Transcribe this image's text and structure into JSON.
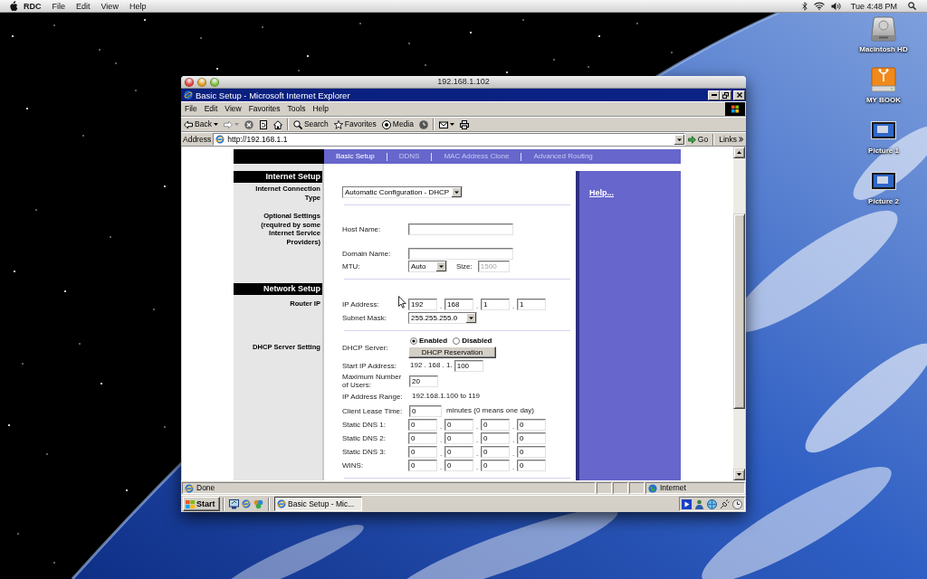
{
  "mac_menu_bar": {
    "app": "RDC",
    "menus": [
      "File",
      "Edit",
      "View",
      "Help"
    ],
    "clock": "Tue 4:48 PM"
  },
  "desktop_icons": [
    {
      "kind": "hard-drive",
      "label": "Macintosh HD"
    },
    {
      "kind": "external-drive",
      "label": "MY BOOK"
    },
    {
      "kind": "picture",
      "label": "Picture 1"
    },
    {
      "kind": "picture",
      "label": "Picture 2"
    }
  ],
  "remote_window": {
    "title": "192.168.1.102"
  },
  "browser": {
    "title": "Basic Setup - Microsoft Internet Explorer",
    "menus": [
      "File",
      "Edit",
      "View",
      "Favorites",
      "Tools",
      "Help"
    ],
    "toolbar": [
      [
        {
          "kind": "back",
          "label": "Back",
          "disabled": false
        },
        {
          "kind": "forward",
          "disabled": true
        },
        {
          "kind": "stop",
          "disabled": false
        },
        {
          "kind": "refresh",
          "disabled": false
        },
        {
          "kind": "home",
          "disabled": false
        }
      ],
      [
        {
          "kind": "search",
          "label": "Search",
          "disabled": false
        },
        {
          "kind": "favorites",
          "label": "Favorites",
          "disabled": false
        },
        {
          "kind": "media",
          "label": "Media",
          "disabled": false
        },
        {
          "kind": "history",
          "disabled": false
        }
      ],
      [
        {
          "kind": "mail",
          "disabled": false
        },
        {
          "kind": "print",
          "disabled": false
        }
      ]
    ],
    "address": {
      "label": "Address",
      "url": "http://192.168.1.1",
      "go": "Go",
      "links": "Links"
    },
    "status_bar": {
      "text": "Done",
      "zone": "Internet"
    }
  },
  "router_page": {
    "nav_tabs": [
      {
        "label": "Basic Setup",
        "selected": true
      },
      {
        "label": "DDNS",
        "selected": false
      },
      {
        "label": "MAC Address Clone",
        "selected": false
      },
      {
        "label": "Advanced Routing",
        "selected": false
      }
    ],
    "help_link": "Help...",
    "ip_separator": ".",
    "sections": [
      {
        "heading": "Internet Setup",
        "groups": [
          {
            "label": "Internet Connection Type",
            "rows": [
              {
                "kind": "select",
                "value": "Automatic Configuration - DHCP"
              }
            ]
          },
          {
            "label": "Optional Settings (required by some Internet Service Providers)",
            "rows": [
              {
                "kind": "text",
                "label": "Host Name:"
              },
              {
                "kind": "text",
                "label": "Domain Name:"
              },
              {
                "kind": "mtu",
                "label": "MTU:",
                "value": "Auto",
                "size_label": "Size:",
                "size": "1500",
                "size_disabled": true
              }
            ]
          }
        ]
      },
      {
        "heading": "Network Setup",
        "groups": [
          {
            "label": "Router IP",
            "rows": [
              {
                "kind": "ip",
                "label": "IP Address:",
                "octets": [
                  "192",
                  "168",
                  "1",
                  "1"
                ]
              },
              {
                "kind": "select",
                "label": "Subnet Mask:",
                "value": "255.255.255.0"
              }
            ]
          },
          {
            "label": "DHCP Server Setting",
            "rows": [
              {
                "kind": "radio",
                "label": "DHCP Server:",
                "options": [
                  {
                    "label": "Enabled",
                    "selected": true
                  },
                  {
                    "label": "Disabled",
                    "selected": false
                  }
                ],
                "button": "DHCP Reservation"
              },
              {
                "kind": "prefixed",
                "label": "Start IP Address:",
                "prefix": "192 . 168 . 1.",
                "value": "100"
              },
              {
                "kind": "number",
                "label": "Maximum Number of Users:",
                "value": "20"
              },
              {
                "kind": "static",
                "label": "IP Address Range:",
                "value": "192.168.1.100 to 119"
              },
              {
                "kind": "number",
                "label": "Client Lease Time:",
                "value": "0",
                "suffix": "minutes (0 means one day)"
              },
              {
                "kind": "ip",
                "label": "Static DNS 1:",
                "octets": [
                  "0",
                  "0",
                  "0",
                  "0"
                ]
              },
              {
                "kind": "ip",
                "label": "Static DNS 2:",
                "octets": [
                  "0",
                  "0",
                  "0",
                  "0"
                ]
              },
              {
                "kind": "ip",
                "label": "Static DNS 3:",
                "octets": [
                  "0",
                  "0",
                  "0",
                  "0"
                ]
              },
              {
                "kind": "ip",
                "label": "WINS:",
                "octets": [
                  "0",
                  "0",
                  "0",
                  "0"
                ]
              }
            ]
          }
        ]
      }
    ]
  },
  "taskbar": {
    "start": "Start",
    "task": "Basic Setup - Mic..."
  }
}
